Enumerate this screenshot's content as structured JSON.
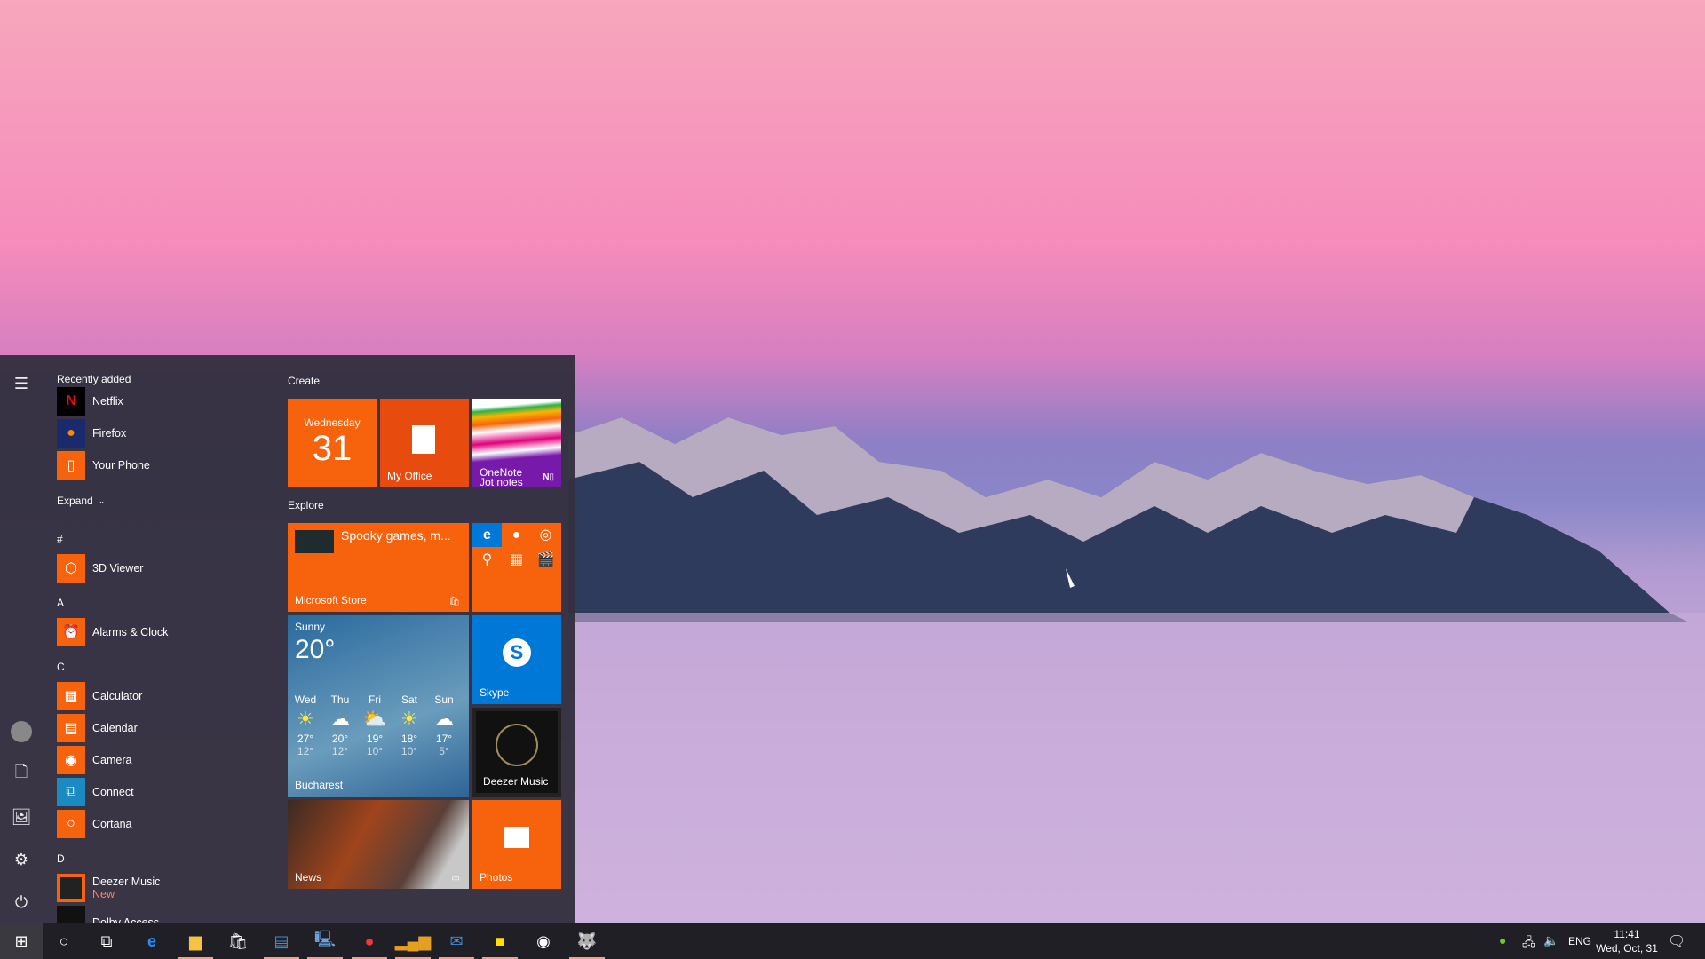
{
  "start_menu": {
    "recently_added_label": "Recently added",
    "recent": [
      {
        "name": "Netflix",
        "icon": "netflix-icon"
      },
      {
        "name": "Firefox",
        "icon": "firefox-icon"
      },
      {
        "name": "Your Phone",
        "icon": "phone-icon"
      }
    ],
    "expand_label": "Expand",
    "groups": [
      {
        "letter": "#",
        "apps": [
          {
            "name": "3D Viewer"
          }
        ]
      },
      {
        "letter": "A",
        "apps": [
          {
            "name": "Alarms & Clock"
          }
        ]
      },
      {
        "letter": "C",
        "apps": [
          {
            "name": "Calculator"
          },
          {
            "name": "Calendar"
          },
          {
            "name": "Camera"
          },
          {
            "name": "Connect"
          },
          {
            "name": "Cortana"
          }
        ]
      },
      {
        "letter": "D",
        "apps": [
          {
            "name": "Deezer Music",
            "badge": "New"
          },
          {
            "name": "Dolby Access"
          }
        ]
      }
    ],
    "tiles": {
      "create_label": "Create",
      "explore_label": "Explore",
      "calendar": {
        "day": "Wednesday",
        "date": "31"
      },
      "office": "My Office",
      "onenote": "OneNote\nJot notes",
      "store": {
        "headline": "Spooky games, m...",
        "name": "Microsoft Store"
      },
      "weather": {
        "condition": "Sunny",
        "temp": "20°",
        "city": "Bucharest",
        "forecast": [
          {
            "day": "Wed",
            "hi": "27°",
            "lo": "12°",
            "icon": "sun"
          },
          {
            "day": "Thu",
            "hi": "20°",
            "lo": "12°",
            "icon": "cloud"
          },
          {
            "day": "Fri",
            "hi": "19°",
            "lo": "10°",
            "icon": "partly-cloudy"
          },
          {
            "day": "Sat",
            "hi": "18°",
            "lo": "10°",
            "icon": "sun"
          },
          {
            "day": "Sun",
            "hi": "17°",
            "lo": "5°",
            "icon": "cloud"
          }
        ]
      },
      "skype": "Skype",
      "deezer": "Deezer Music",
      "news": "News",
      "photos": "Photos"
    }
  },
  "colors": {
    "accent": "#f7630c",
    "office": "#e74b0e",
    "skype": "#0078d7",
    "badge_new": "#f7836b"
  },
  "tray": {
    "language": "ENG",
    "time": "11:41",
    "date": "Wed, Oct, 31"
  }
}
